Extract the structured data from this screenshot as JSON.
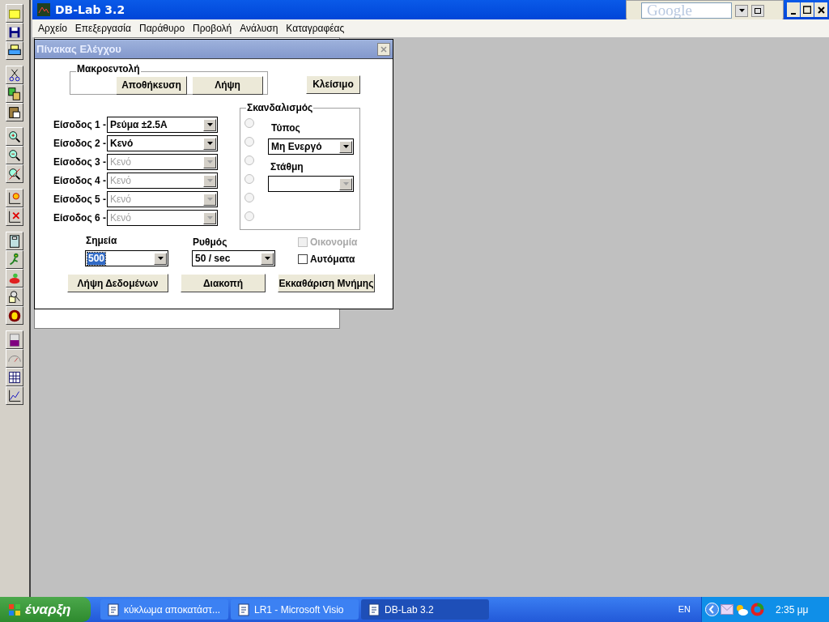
{
  "app": {
    "title": "DB-Lab 3.2"
  },
  "menu": [
    "Αρχείο",
    "Επεξεργασία",
    "Παράθυρο",
    "Προβολή",
    "Ανάλυση",
    "Καταγραφέας"
  ],
  "google": {
    "placeholder": "Google"
  },
  "dialog": {
    "title": "Πίνακας Ελέγχου",
    "macro": {
      "label": "Μακροεντολή",
      "buttons": [
        "Αποθήκευση",
        "Λήψη"
      ]
    },
    "close_button": "Κλείσιμο",
    "inputs": [
      {
        "label": "Είσοδος 1 -",
        "value": "Ρεύμα ±2.5A",
        "disabled": false
      },
      {
        "label": "Είσοδος 2 -",
        "value": "Κενό",
        "disabled": false
      },
      {
        "label": "Είσοδος 3 -",
        "value": "Κενό",
        "disabled": true
      },
      {
        "label": "Είσοδος 4 -",
        "value": "Κενό",
        "disabled": true
      },
      {
        "label": "Είσοδος 5 -",
        "value": "Κενό",
        "disabled": true
      },
      {
        "label": "Είσοδος 6 -",
        "value": "Κενό",
        "disabled": true
      }
    ],
    "trigger": {
      "label": "Σκανδαλισμός",
      "radios": [
        {
          "selected": false,
          "disabled": true
        },
        {
          "selected": false,
          "disabled": true
        },
        {
          "selected": false,
          "disabled": true
        },
        {
          "selected": false,
          "disabled": true
        },
        {
          "selected": false,
          "disabled": true
        },
        {
          "selected": false,
          "disabled": true
        }
      ],
      "type": {
        "label": "Τύπος",
        "value": "Μη Ενεργό",
        "disabled": false
      },
      "level": {
        "label": "Στάθμη",
        "disabled": true
      }
    },
    "points": {
      "label": "Σημεία",
      "value": "500",
      "focused": true
    },
    "rate": {
      "label": "Ρυθμός",
      "value": "50 / sec",
      "focused": false
    },
    "checkboxes": [
      {
        "label": "Οικονομία",
        "checked": false,
        "disabled": true
      },
      {
        "label": "Αυτόματα",
        "checked": false,
        "disabled": false
      }
    ],
    "actions": [
      "Λήψη Δεδομένων",
      "Διακοπή",
      "Εκκαθάριση Μνήμης"
    ]
  },
  "taskbar": {
    "start": "έναρξη",
    "tasks": [
      {
        "label": "κύκλωμα αποκατάστ...",
        "selected": false
      },
      {
        "label": "LR1 - Microsoft Visio",
        "selected": false
      },
      {
        "label": "DB-Lab 3.2",
        "selected": true
      }
    ],
    "language": "EN",
    "clock": "2:35 μμ"
  }
}
